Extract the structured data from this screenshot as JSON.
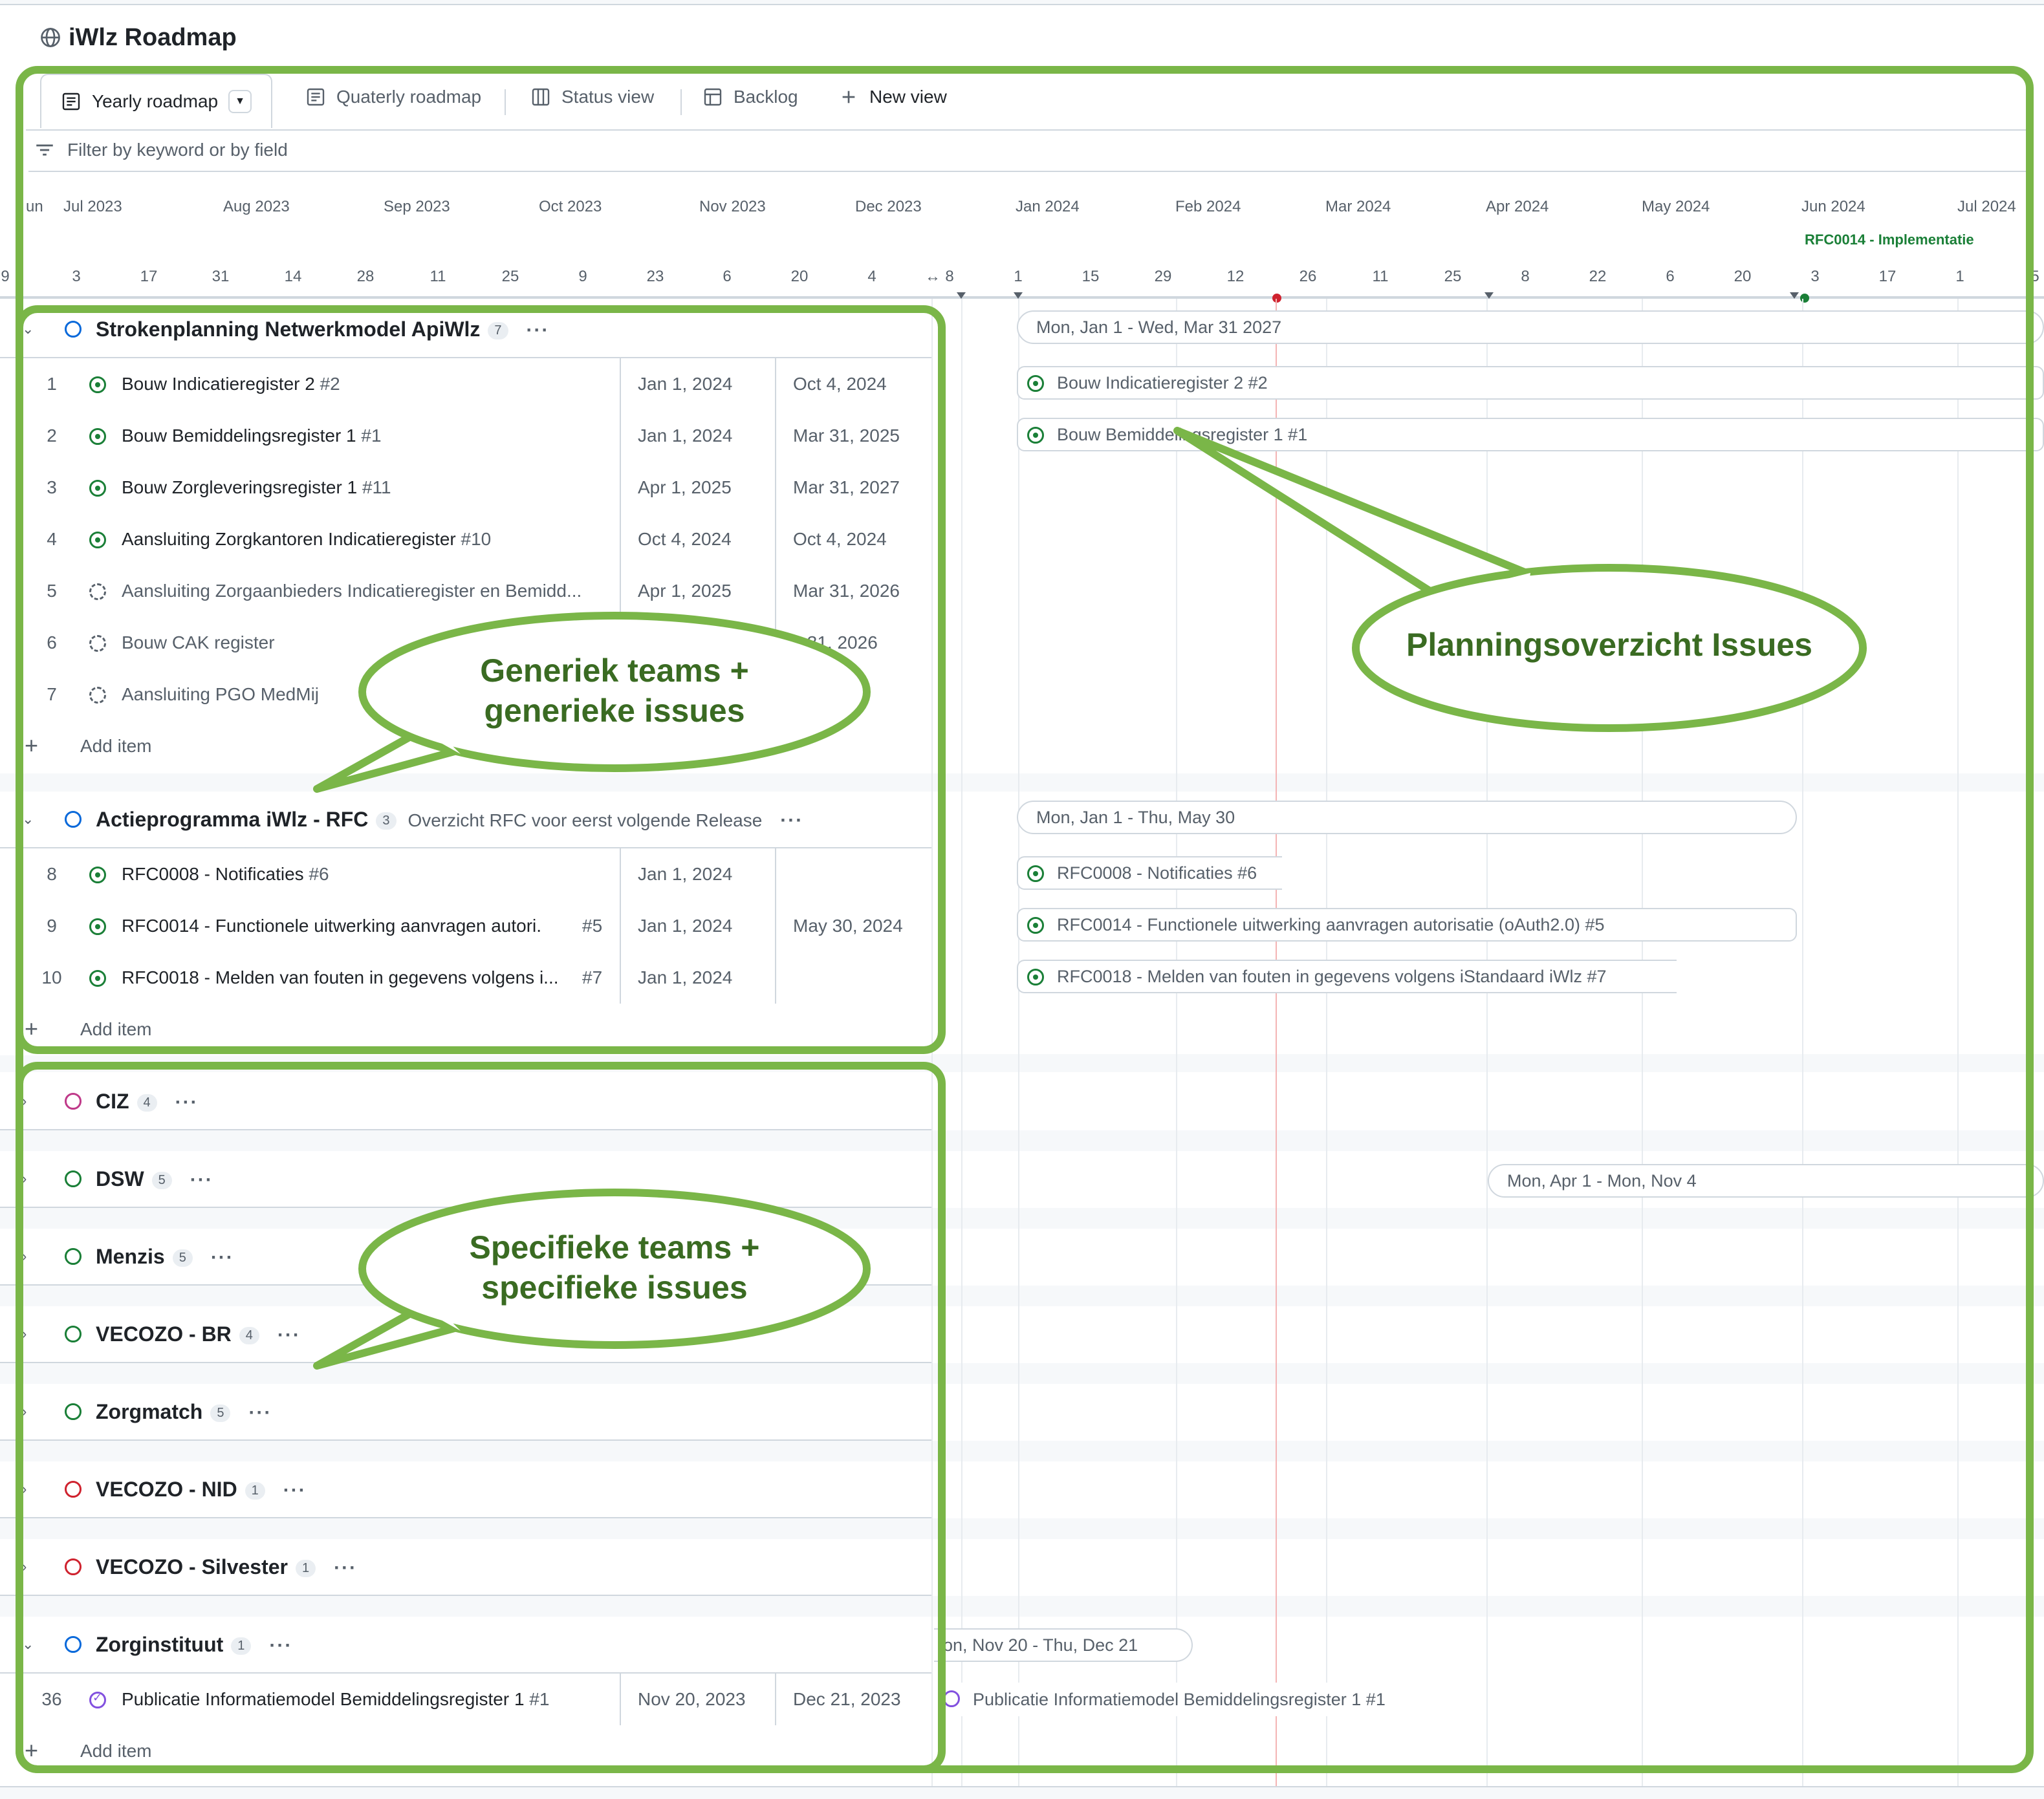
{
  "project": {
    "title": "iWlz Roadmap"
  },
  "tabs": [
    {
      "label": "Yearly roadmap",
      "active": true,
      "icon": "table-icon"
    },
    {
      "label": "Quaterly roadmap",
      "icon": "table-icon"
    },
    {
      "label": "Status view",
      "icon": "board-icon"
    },
    {
      "label": "Backlog",
      "icon": "table-icon"
    },
    {
      "label": "New view",
      "icon": "plus-icon"
    }
  ],
  "filter": {
    "placeholder": "Filter by keyword or by field"
  },
  "timeline": {
    "months": [
      "un",
      "Jul 2023",
      "Aug 2023",
      "Sep 2023",
      "Oct 2023",
      "Nov 2023",
      "Dec 2023",
      "Jan 2024",
      "Feb 2024",
      "Mar 2024",
      "Apr 2024",
      "May 2024",
      "Jun 2024",
      "Jul 2024"
    ],
    "days": [
      "9",
      "3",
      "17",
      "31",
      "14",
      "28",
      "11",
      "25",
      "9",
      "23",
      "6",
      "20",
      "4",
      "8",
      "1",
      "15",
      "29",
      "12",
      "26",
      "11",
      "25",
      "8",
      "22",
      "6",
      "20",
      "3",
      "17",
      "1",
      "5"
    ],
    "resize_glyph": "↔",
    "milestone": "RFC0014 - Implementatie"
  },
  "groups": [
    {
      "name": "Strokenplanning Netwerkmodel ApiWlz",
      "count": "7",
      "color": "#0969da",
      "bar": "Mon, Jan 1 - Wed, Mar 31 2027",
      "items": [
        {
          "num": "1",
          "title": "Bouw Indicatieregister 2",
          "ref": "#2",
          "start": "Jan 1, 2024",
          "end": "Oct 4, 2024",
          "status": "open",
          "bar": "Bouw Indicatieregister 2 #2"
        },
        {
          "num": "2",
          "title": "Bouw Bemiddelingsregister 1",
          "ref": "#1",
          "start": "Jan 1, 2024",
          "end": "Mar 31, 2025",
          "status": "open",
          "bar": "Bouw Bemiddelingsregister 1 #1"
        },
        {
          "num": "3",
          "title": "Bouw Zorgleveringsregister 1",
          "ref": "#11",
          "start": "Apr 1, 2025",
          "end": "Mar 31, 2027",
          "status": "open"
        },
        {
          "num": "4",
          "title": "Aansluiting Zorgkantoren Indicatieregister",
          "ref": "#10",
          "start": "Oct 4, 2024",
          "end": "Oct 4, 2024",
          "status": "open"
        },
        {
          "num": "5",
          "title": "Aansluiting Zorgaanbieders Indicatieregister en Bemidd...",
          "ref": "",
          "start": "Apr 1, 2025",
          "end": "Mar 31, 2026",
          "status": "draft"
        },
        {
          "num": "6",
          "title": "Bouw CAK register",
          "ref": "",
          "start": "",
          "end": "c 31, 2026",
          "status": "draft"
        },
        {
          "num": "7",
          "title": "Aansluiting PGO MedMij",
          "ref": "",
          "start": "",
          "end": "",
          "status": "draft"
        }
      ],
      "add_label": "Add item"
    },
    {
      "name": "Actieprogramma iWlz - RFC",
      "count": "3",
      "desc": "Overzicht RFC voor eerst volgende Release",
      "color": "#0969da",
      "bar": "Mon, Jan 1 - Thu, May 30",
      "items": [
        {
          "num": "8",
          "title": "RFC0008 - Notificaties",
          "ref": "#6",
          "start": "Jan 1, 2024",
          "end": "",
          "status": "open",
          "bar": "RFC0008 - Notificaties #6"
        },
        {
          "num": "9",
          "title": "RFC0014 - Functionele uitwerking aanvragen autori...",
          "ref": "#5",
          "start": "Jan 1, 2024",
          "end": "May 30, 2024",
          "status": "open",
          "bar": "RFC0014 - Functionele uitwerking aanvragen autorisatie (oAuth2.0) #5"
        },
        {
          "num": "10",
          "title": "RFC0018 - Melden van fouten in gegevens volgens i...",
          "ref": "#7",
          "start": "Jan 1, 2024",
          "end": "",
          "status": "open",
          "bar": "RFC0018 - Melden van fouten in gegevens volgens iStandaard iWlz #7"
        }
      ],
      "add_label": "Add item"
    }
  ],
  "collapsed_groups": [
    {
      "name": "CIZ",
      "count": "4",
      "color": "#bf3989"
    },
    {
      "name": "DSW",
      "count": "5",
      "color": "#1a7f37",
      "bar": "Mon, Apr 1 - Mon, Nov 4"
    },
    {
      "name": "Menzis",
      "count": "5",
      "color": "#1a7f37"
    },
    {
      "name": "VECOZO - BR",
      "count": "4",
      "color": "#1a7f37"
    },
    {
      "name": "Zorgmatch",
      "count": "5",
      "color": "#1a7f37"
    },
    {
      "name": "VECOZO - NID",
      "count": "1",
      "color": "#cf222e"
    },
    {
      "name": "VECOZO - Silvester",
      "count": "1",
      "color": "#cf222e"
    }
  ],
  "zorginstituut": {
    "name": "Zorginstituut",
    "count": "1",
    "color": "#0969da",
    "bar": "on, Nov 20 - Thu, Dec 21",
    "item": {
      "num": "36",
      "title": "Publicatie Informatiemodel Bemiddelingsregister 1",
      "ref": "#1",
      "start": "Nov 20, 2023",
      "end": "Dec 21, 2023",
      "status": "done",
      "bar": "Publicatie Informatiemodel Bemiddelingsregister 1 #1"
    },
    "add_label": "Add item"
  },
  "more_glyph": "···",
  "callouts": {
    "generic": [
      "Generiek teams +",
      "generieke issues"
    ],
    "specific": [
      "Specifieke teams +",
      "specifieke issues"
    ],
    "planning": [
      "Planningsoverzicht Issues"
    ]
  },
  "colors": {
    "annotation": "#7ab648",
    "annotation_fill": "#ffffff",
    "annotation_text": "#3a6b22",
    "today_line": "#f4b4b4"
  }
}
